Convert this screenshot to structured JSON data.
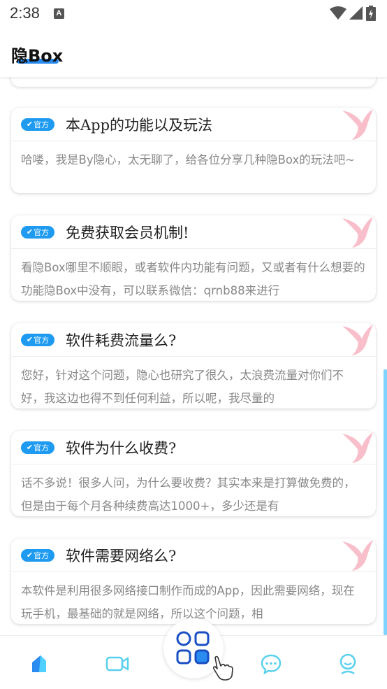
{
  "status_bar": {
    "time": "2:38",
    "notification_badge": "A"
  },
  "header": {
    "title": "隐Box",
    "accent_color": "#2a8cf0"
  },
  "badge_label": "官方",
  "cards": [
    {
      "title": "本App的功能以及玩法",
      "body": "哈喽，我是By隐心，太无聊了，给各位分享几种隐Box的玩法吧~"
    },
    {
      "title": "免费获取会员机制!",
      "body": "看隐Box哪里不顺眼，或者软件内功能有问题，又或者有什么想要的功能隐Box中没有，可以联系微信：qrnb88来进行"
    },
    {
      "title": "软件耗费流量么?",
      "body": "您好，针对这个问题，隐心也研究了很久，太浪费流量对你们不好，我这边也得不到任何利益，所以呢，我尽量的"
    },
    {
      "title": "软件为什么收费?",
      "body": "话不多说！很多人问，为什么要收费？其实本来是打算做免费的，但是由于每个月各种续费高达1000+，多少还是有"
    },
    {
      "title": "软件需要网络么?",
      "body": "本软件是利用很多网络接口制作而成的App，因此需要网络，现在玩手机，最基础的就是网络，所以这个问题，相"
    }
  ],
  "bottom_nav": {
    "items": [
      {
        "icon": "home-icon"
      },
      {
        "icon": "video-icon"
      },
      {
        "icon": "apps-grid-icon"
      },
      {
        "icon": "chat-icon"
      },
      {
        "icon": "profile-icon"
      }
    ]
  },
  "colors": {
    "badge_blue": "#1e9bf0",
    "scroll_indicator": "#7fd3ff",
    "deco_pink": "#f28aa0"
  }
}
